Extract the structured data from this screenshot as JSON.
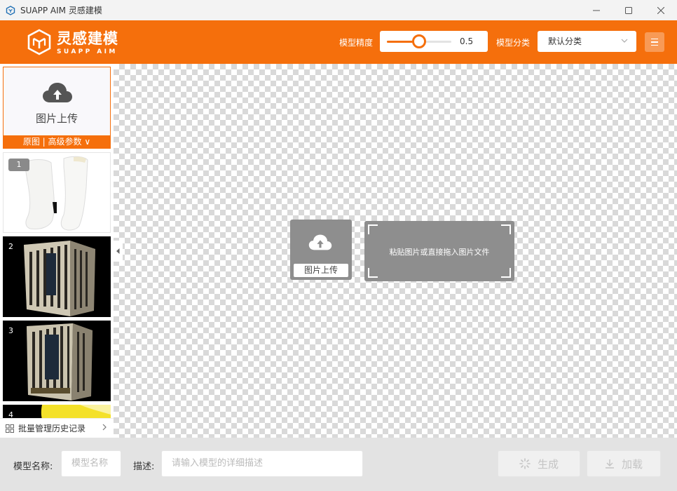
{
  "window": {
    "title": "SUAPP AIM 灵感建模",
    "controls": [
      "minimize-icon",
      "maximize-icon",
      "close-icon"
    ]
  },
  "header": {
    "brand_cn": "灵感建模",
    "brand_en": "SUAPP AIM",
    "precision_label": "模型精度",
    "precision_value": "0.5",
    "precision_fraction": 0.5,
    "category_label": "模型分类",
    "category_selected": "默认分类",
    "accent_color": "#f56f0c"
  },
  "sidebar": {
    "upload_label": "图片上传",
    "options_bar": "原图 | 高级参数 ∨",
    "thumbnails": [
      {
        "num": "1",
        "subject": "white boots"
      },
      {
        "num": "2",
        "subject": "building"
      },
      {
        "num": "3",
        "subject": "building"
      },
      {
        "num": "4",
        "subject": "yellow object"
      }
    ],
    "history_label": "批量管理历史记录"
  },
  "canvas": {
    "upload_button": "图片上传",
    "paste_hint": "粘贴图片或直接拖入图片文件"
  },
  "bottom": {
    "name_label": "模型名称:",
    "name_placeholder": "模型名称",
    "desc_label": "描述:",
    "desc_placeholder": "请输入模型的详细描述",
    "generate_label": "生成",
    "load_label": "加载"
  }
}
